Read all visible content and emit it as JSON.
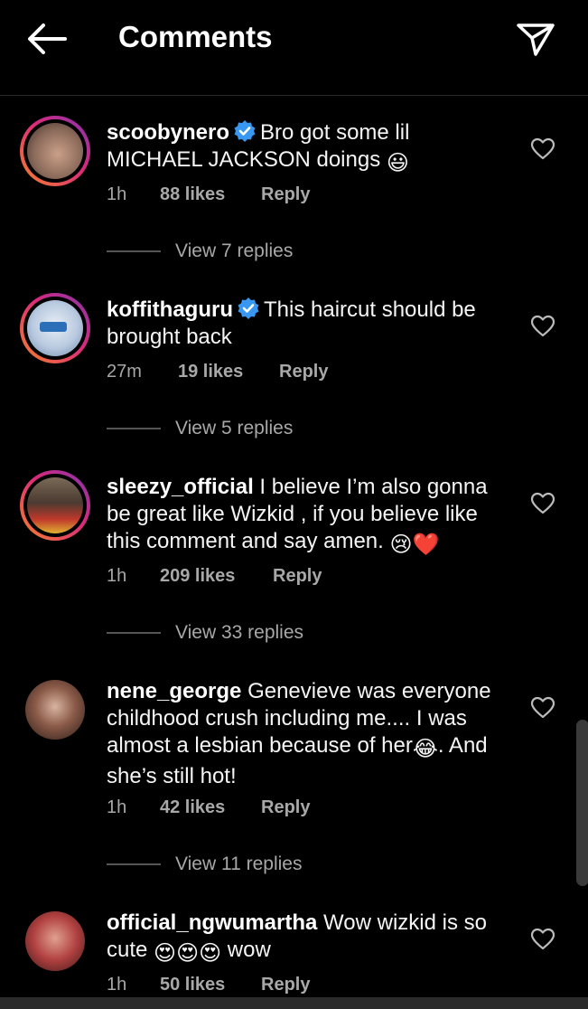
{
  "header": {
    "title": "Comments",
    "back_icon": "arrow-left-icon",
    "share_icon": "paper-plane-icon"
  },
  "comments": [
    {
      "username": "scoobynero",
      "verified": true,
      "text": "Bro got some lil MICHAEL JACKSON doings",
      "emoji": "😃",
      "time": "1h",
      "likes": "88 likes",
      "reply": "Reply",
      "view_replies": "View 7 replies",
      "avatar_story": true
    },
    {
      "username": "koffithaguru",
      "verified": true,
      "text": "This haircut should be brought back",
      "time": "27m",
      "likes": "19 likes",
      "reply": "Reply",
      "view_replies": "View 5 replies",
      "avatar_story": true
    },
    {
      "username": "sleezy_official",
      "verified": false,
      "text": "I believe I’m also gonna be great like Wizkid , if you believe like this comment and say amen.",
      "emoji": "😢❤️",
      "time": "1h",
      "likes": "209 likes",
      "reply": "Reply",
      "view_replies": "View 33 replies",
      "avatar_story": true
    },
    {
      "username": "nene_george",
      "verified": false,
      "text_before": "Genevieve was everyone childhood crush including me.... I was almost a lesbian because of her",
      "emoji": "😂",
      "text_after": ". And she’s still hot!",
      "time": "1h",
      "likes": "42 likes",
      "reply": "Reply",
      "view_replies": "View 11 replies",
      "avatar_story": false
    },
    {
      "username": "official_ngwumartha",
      "verified": false,
      "text_before": "Wow wizkid is so cute",
      "emoji": "😍😍😍",
      "text_after": "wow",
      "time": "1h",
      "likes": "50 likes",
      "reply": "Reply",
      "avatar_story": false
    }
  ],
  "colors": {
    "background": "#000000",
    "verified": "#3897f0",
    "muted": "#a8a8a8"
  }
}
